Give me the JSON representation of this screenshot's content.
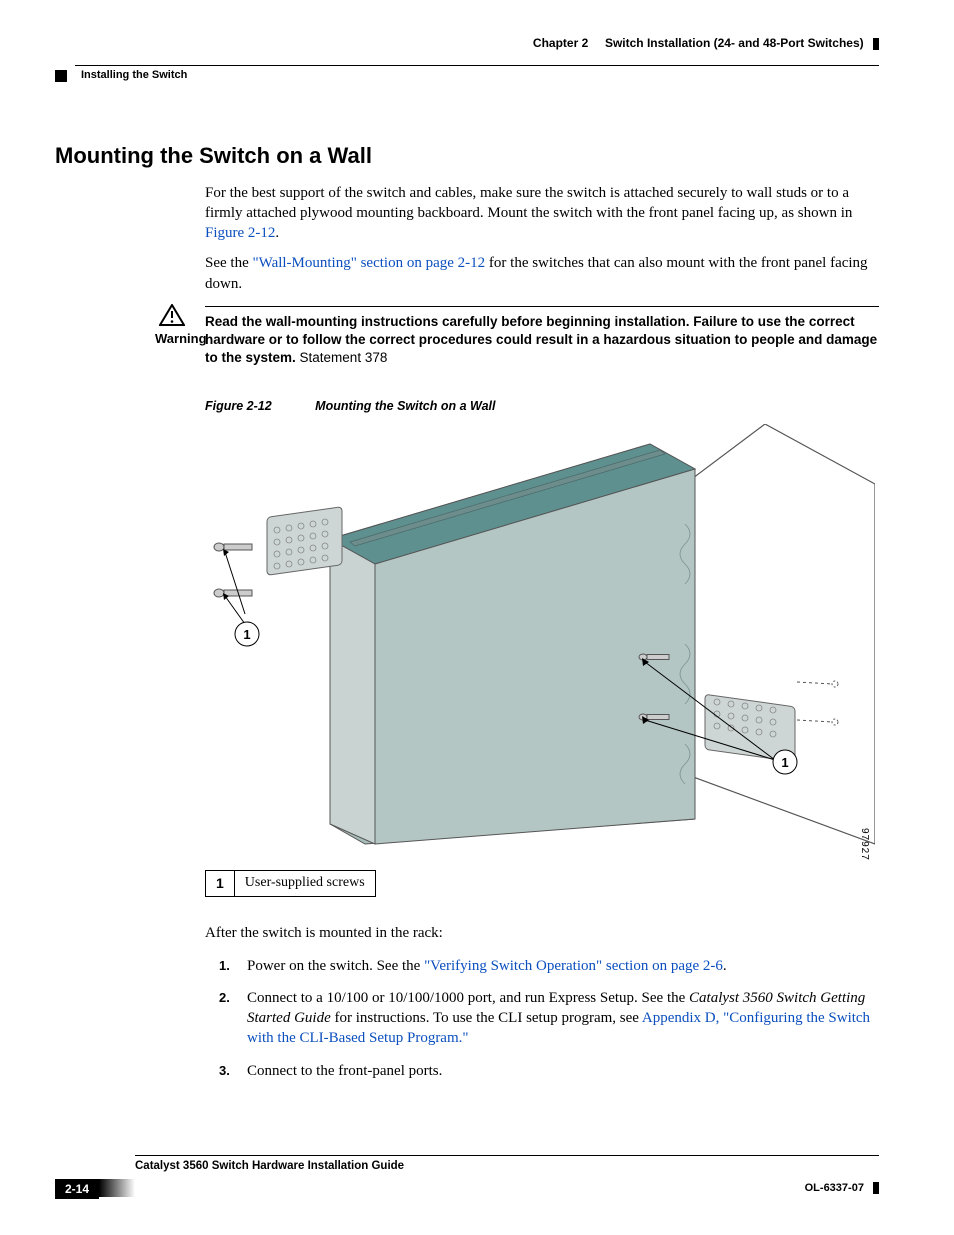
{
  "header": {
    "chapter_label": "Chapter 2",
    "chapter_title": "Switch Installation (24- and 48-Port Switches)",
    "section_crumb": "Installing the Switch"
  },
  "heading": "Mounting the Switch on a Wall",
  "para1_a": "For the best support of the switch and cables, make sure the switch is attached securely to wall studs or to a firmly attached plywood mounting backboard. Mount the switch with the front panel facing up, as shown in ",
  "para1_link": "Figure 2-12",
  "para1_b": ".",
  "para2_a": "See the ",
  "para2_link": "\"Wall-Mounting\" section on page 2-12",
  "para2_b": " for the switches that can also mount with the front panel facing down.",
  "warning": {
    "label": "Warning",
    "bold_text": "Read the wall-mounting instructions carefully before beginning installation. Failure to use the correct hardware or to follow the correct procedures could result in a hazardous situation to people and damage to the system.",
    "tail": " Statement 378"
  },
  "figure": {
    "number": "Figure 2-12",
    "title": "Mounting the Switch on a Wall",
    "image_id": "97927",
    "callout_1": "1",
    "callout_2": "1"
  },
  "legend": {
    "num": "1",
    "text": "User-supplied screws"
  },
  "after_para": "After the switch is mounted in the rack:",
  "steps": {
    "s1_a": "Power on the switch. See the ",
    "s1_link": "\"Verifying Switch Operation\" section on page 2-6",
    "s1_b": ".",
    "s2_a": "Connect to a 10/100 or 10/100/1000 port, and run Express Setup. See the ",
    "s2_i": "Catalyst 3560 Switch Getting Started Guide",
    "s2_b": " for instructions. To use the CLI setup program, see ",
    "s2_link": "Appendix D, \"Configuring the Switch with the CLI-Based Setup Program.\"",
    "s3": "Connect to the front-panel ports."
  },
  "footer": {
    "guide_title": "Catalyst 3560 Switch Hardware Installation Guide",
    "page_number": "2-14",
    "doc_id": "OL-6337-07"
  }
}
